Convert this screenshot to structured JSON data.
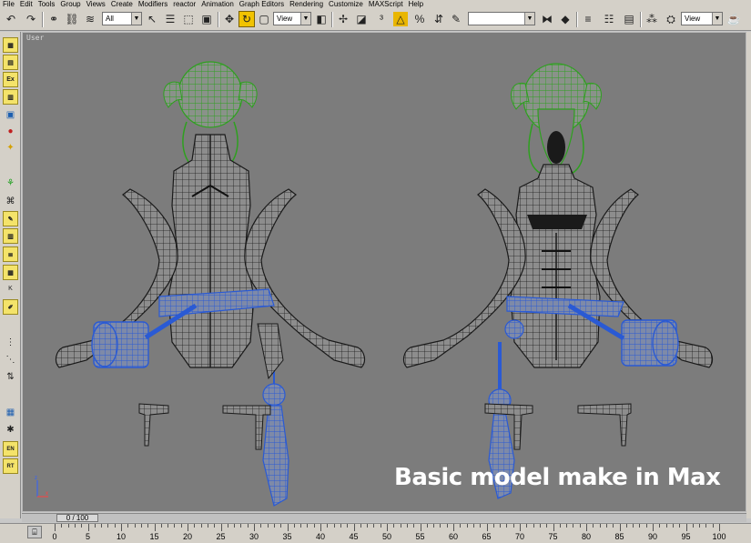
{
  "menu": [
    "File",
    "Edit",
    "Tools",
    "Group",
    "Views",
    "Create",
    "Modifiers",
    "reactor",
    "Animation",
    "Graph Editors",
    "Rendering",
    "Customize",
    "MAXScript",
    "Help"
  ],
  "toolbar": {
    "selection_filter": "All",
    "ref_coord_1": "View",
    "named_selection": "",
    "ref_coord_2": "View"
  },
  "viewport": {
    "label": "User",
    "caption": "Basic model make in Max",
    "axis_x": "x",
    "axis_y": "z"
  },
  "timeline": {
    "frame_display": "0 / 100",
    "ticks": [
      "0",
      "5",
      "10",
      "15",
      "20",
      "25",
      "30",
      "35",
      "40",
      "45",
      "50",
      "55",
      "60",
      "65",
      "70",
      "75",
      "80",
      "85",
      "90",
      "95",
      "100"
    ]
  },
  "colors": {
    "viewport_bg": "#7c7c7c",
    "hair_wire": "#2ea01f",
    "accessory_wire": "#2a5ad4",
    "body_wire": "#1a1a1a",
    "active_button": "#f1c300"
  }
}
